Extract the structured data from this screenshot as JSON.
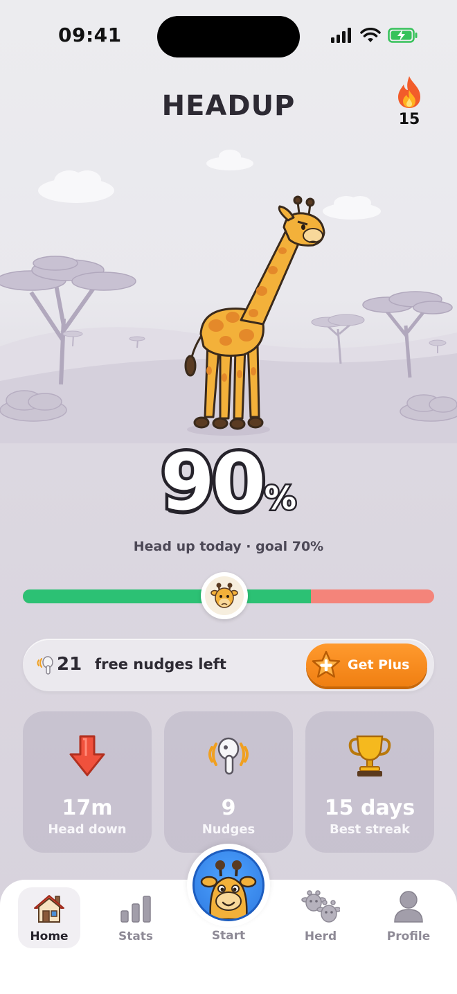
{
  "status_bar": {
    "time": "09:41"
  },
  "header": {
    "title": "HEADUP",
    "streak_count": "15"
  },
  "score": {
    "value": "90",
    "unit": "%",
    "caption": "Head up today · goal 70%",
    "progress": 0.9,
    "goal": 0.7
  },
  "banner": {
    "count": "21",
    "text": "free nudges left",
    "button_label": "Get Plus"
  },
  "stats": [
    {
      "value": "17m",
      "label": "Head down",
      "icon": "down-arrow-icon"
    },
    {
      "value": "9",
      "label": "Nudges",
      "icon": "earbud-icon"
    },
    {
      "value": "15 days",
      "label": "Best streak",
      "icon": "trophy-icon"
    }
  ],
  "tabs": {
    "home": "Home",
    "stats": "Stats",
    "start": "Start",
    "herd": "Herd",
    "profile": "Profile"
  },
  "colors": {
    "good": "#2cc174",
    "bad": "#f4847a",
    "accent": "#f07f12",
    "start": "#2e79e0"
  }
}
